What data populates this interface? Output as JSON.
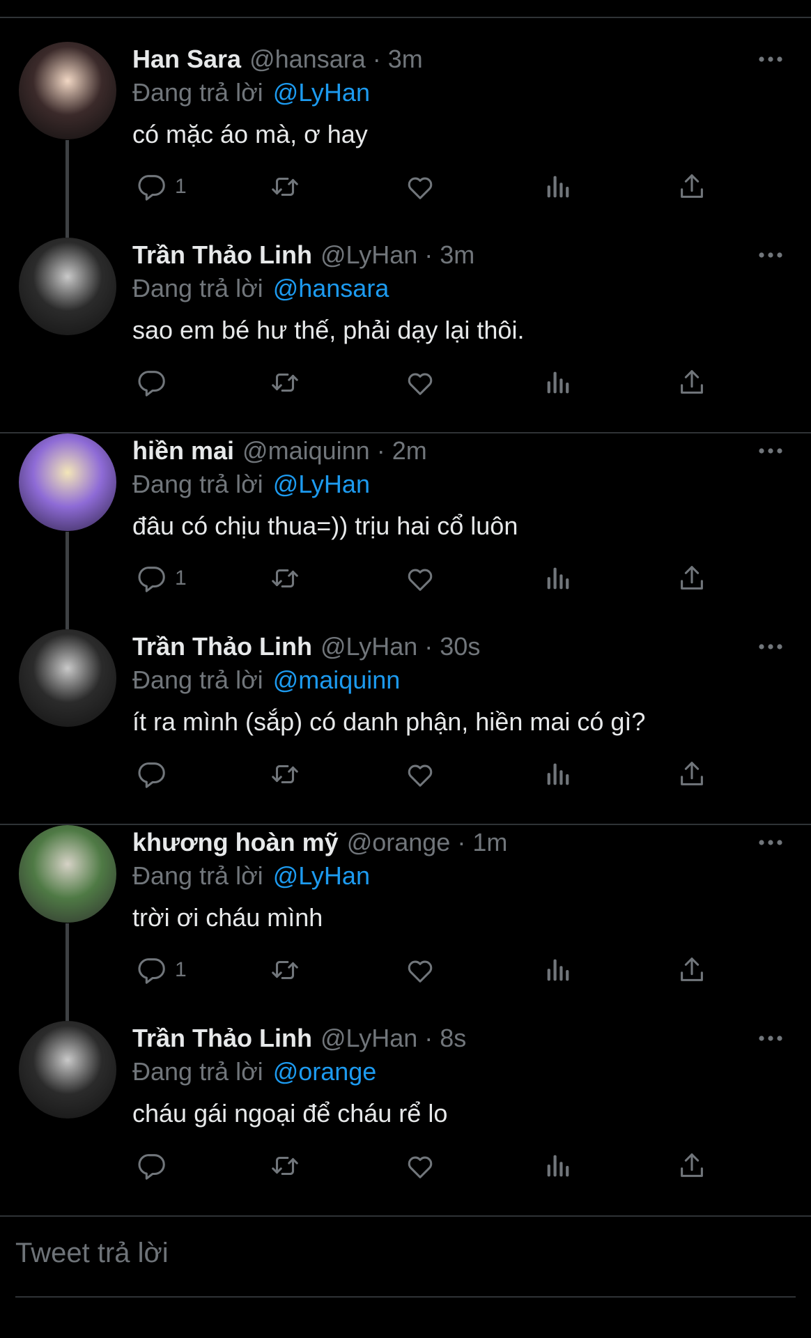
{
  "colors": {
    "background": "#000000",
    "text": "#e7e9ea",
    "muted": "#71767b",
    "accent": "#1d9bf0",
    "divider": "#2f3336"
  },
  "icons": {
    "reply": "reply-icon",
    "retweet": "retweet-icon",
    "like": "heart-icon",
    "views": "analytics-icon",
    "share": "share-icon",
    "more": "more-icon"
  },
  "tweets": [
    {
      "name": "Han Sara",
      "handle": "@hansara",
      "time": "3m",
      "replying_label": "Đang trả lời",
      "mention": "@LyHan",
      "text": "có mặc áo mà, ơ hay",
      "reply_count": "1",
      "thread_line": true
    },
    {
      "name": "Trần Thảo Linh",
      "handle": "@LyHan",
      "time": "3m",
      "replying_label": "Đang trả lời",
      "mention": "@hansara",
      "text": "sao em bé hư thế, phải dạy lại thôi.",
      "reply_count": "",
      "thread_line": false
    },
    {
      "name": "hiền mai",
      "handle": "@maiquinn",
      "time": "2m",
      "replying_label": "Đang trả lời",
      "mention": "@LyHan",
      "text": "đâu có chịu thua=)) trịu hai cổ luôn",
      "reply_count": "1",
      "thread_line": true
    },
    {
      "name": "Trần Thảo Linh",
      "handle": "@LyHan",
      "time": "30s",
      "replying_label": "Đang trả lời",
      "mention": "@maiquinn",
      "text": "ít ra mình (sắp) có danh phận, hiền mai có gì?",
      "reply_count": "",
      "thread_line": false
    },
    {
      "name": "khương hoàn mỹ",
      "handle": "@orange",
      "time": "1m",
      "replying_label": "Đang trả lời",
      "mention": "@LyHan",
      "text": "trời ơi cháu mình",
      "reply_count": "1",
      "thread_line": true
    },
    {
      "name": "Trần Thảo Linh",
      "handle": "@LyHan",
      "time": "8s",
      "replying_label": "Đang trả lời",
      "mention": "@orange",
      "text": "cháu gái ngoại để cháu rể lo",
      "reply_count": "",
      "thread_line": false
    }
  ],
  "reply_input": {
    "placeholder": "Tweet trả lời"
  }
}
